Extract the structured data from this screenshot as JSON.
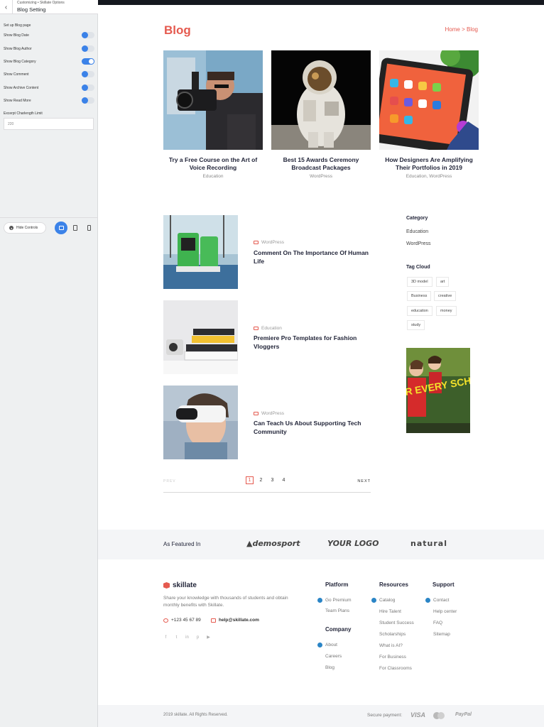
{
  "customizer": {
    "breadcrumb": "Customizing • Skillate Options",
    "title": "Blog Setting",
    "section": "Set up Blog page",
    "toggles": [
      {
        "label": "Show Blog Date",
        "on": false
      },
      {
        "label": "Show Blog Author",
        "on": false
      },
      {
        "label": "Show Blog Category",
        "on": true
      },
      {
        "label": "Show Comment",
        "on": false
      },
      {
        "label": "Show Archive Content",
        "on": false
      },
      {
        "label": "Show Read More",
        "on": false
      }
    ],
    "excerpt_label": "Excerpt Charlength Limit",
    "excerpt_value": "220",
    "hide_controls": "Hide Controls"
  },
  "page": {
    "title": "Blog",
    "breadcrumb": "Home > Blog"
  },
  "featured_posts": [
    {
      "title": "Try a Free Course on the Art of Voice Recording",
      "category": "Education"
    },
    {
      "title": "Best 15 Awards Ceremony Broadcast Packages",
      "category": "WordPress"
    },
    {
      "title": "How Designers Are Amplifying Their Portfolios in 2019",
      "category": "Education, WordPress"
    }
  ],
  "posts": [
    {
      "category": "WordPress",
      "title": "Comment On The Importance Of Human Life"
    },
    {
      "category": "Education",
      "title": "Premiere Pro Templates for Fashion Vloggers"
    },
    {
      "category": "WordPress",
      "title": "Can Teach Us About Supporting Tech Community"
    }
  ],
  "pagination": {
    "prev": "PREV",
    "next": "NEXT",
    "pages": [
      "1",
      "2",
      "3",
      "4"
    ],
    "current": "1"
  },
  "sidebar": {
    "category_heading": "Category",
    "categories": [
      "Education",
      "WordPress"
    ],
    "tag_heading": "Tag Cloud",
    "tags": [
      "3D model",
      "art",
      "Business",
      "creative",
      "education",
      "money",
      "study"
    ],
    "ad_text": "FOR EVERY SCHOOL DAY"
  },
  "featured_in": {
    "label": "As Featured In",
    "logos": [
      "demosport",
      "YOUR LOGO",
      "natural"
    ]
  },
  "footer": {
    "brand": "skillate",
    "description": "Share your knowledge with thousands of students and obtain monthly benefits with Skillate.",
    "phone": "+123 45 67 89",
    "email": "help@skillate.com",
    "platform": {
      "heading": "Platform",
      "links": [
        "Go Premium",
        "Team Plans"
      ]
    },
    "company": {
      "heading": "Company",
      "links": [
        "About",
        "Careers",
        "Blog"
      ]
    },
    "resources": {
      "heading": "Resources",
      "links": [
        "Catalog",
        "Hire Talent",
        "Student Success",
        "Scholarships",
        "What is AI?",
        "For Business",
        "For Classrooms"
      ]
    },
    "support": {
      "heading": "Support",
      "links": [
        "Contact",
        "Help center",
        "FAQ",
        "Sitemap"
      ]
    },
    "copyright": "2019 skillate. All Rights Reserved.",
    "secure_payment": "Secure payment:",
    "payment_visa": "VISA",
    "payment_paypal": "PayPal"
  },
  "colors": {
    "accent": "#e55a4f",
    "toggle": "#3b82e8",
    "heading": "#23263a"
  }
}
